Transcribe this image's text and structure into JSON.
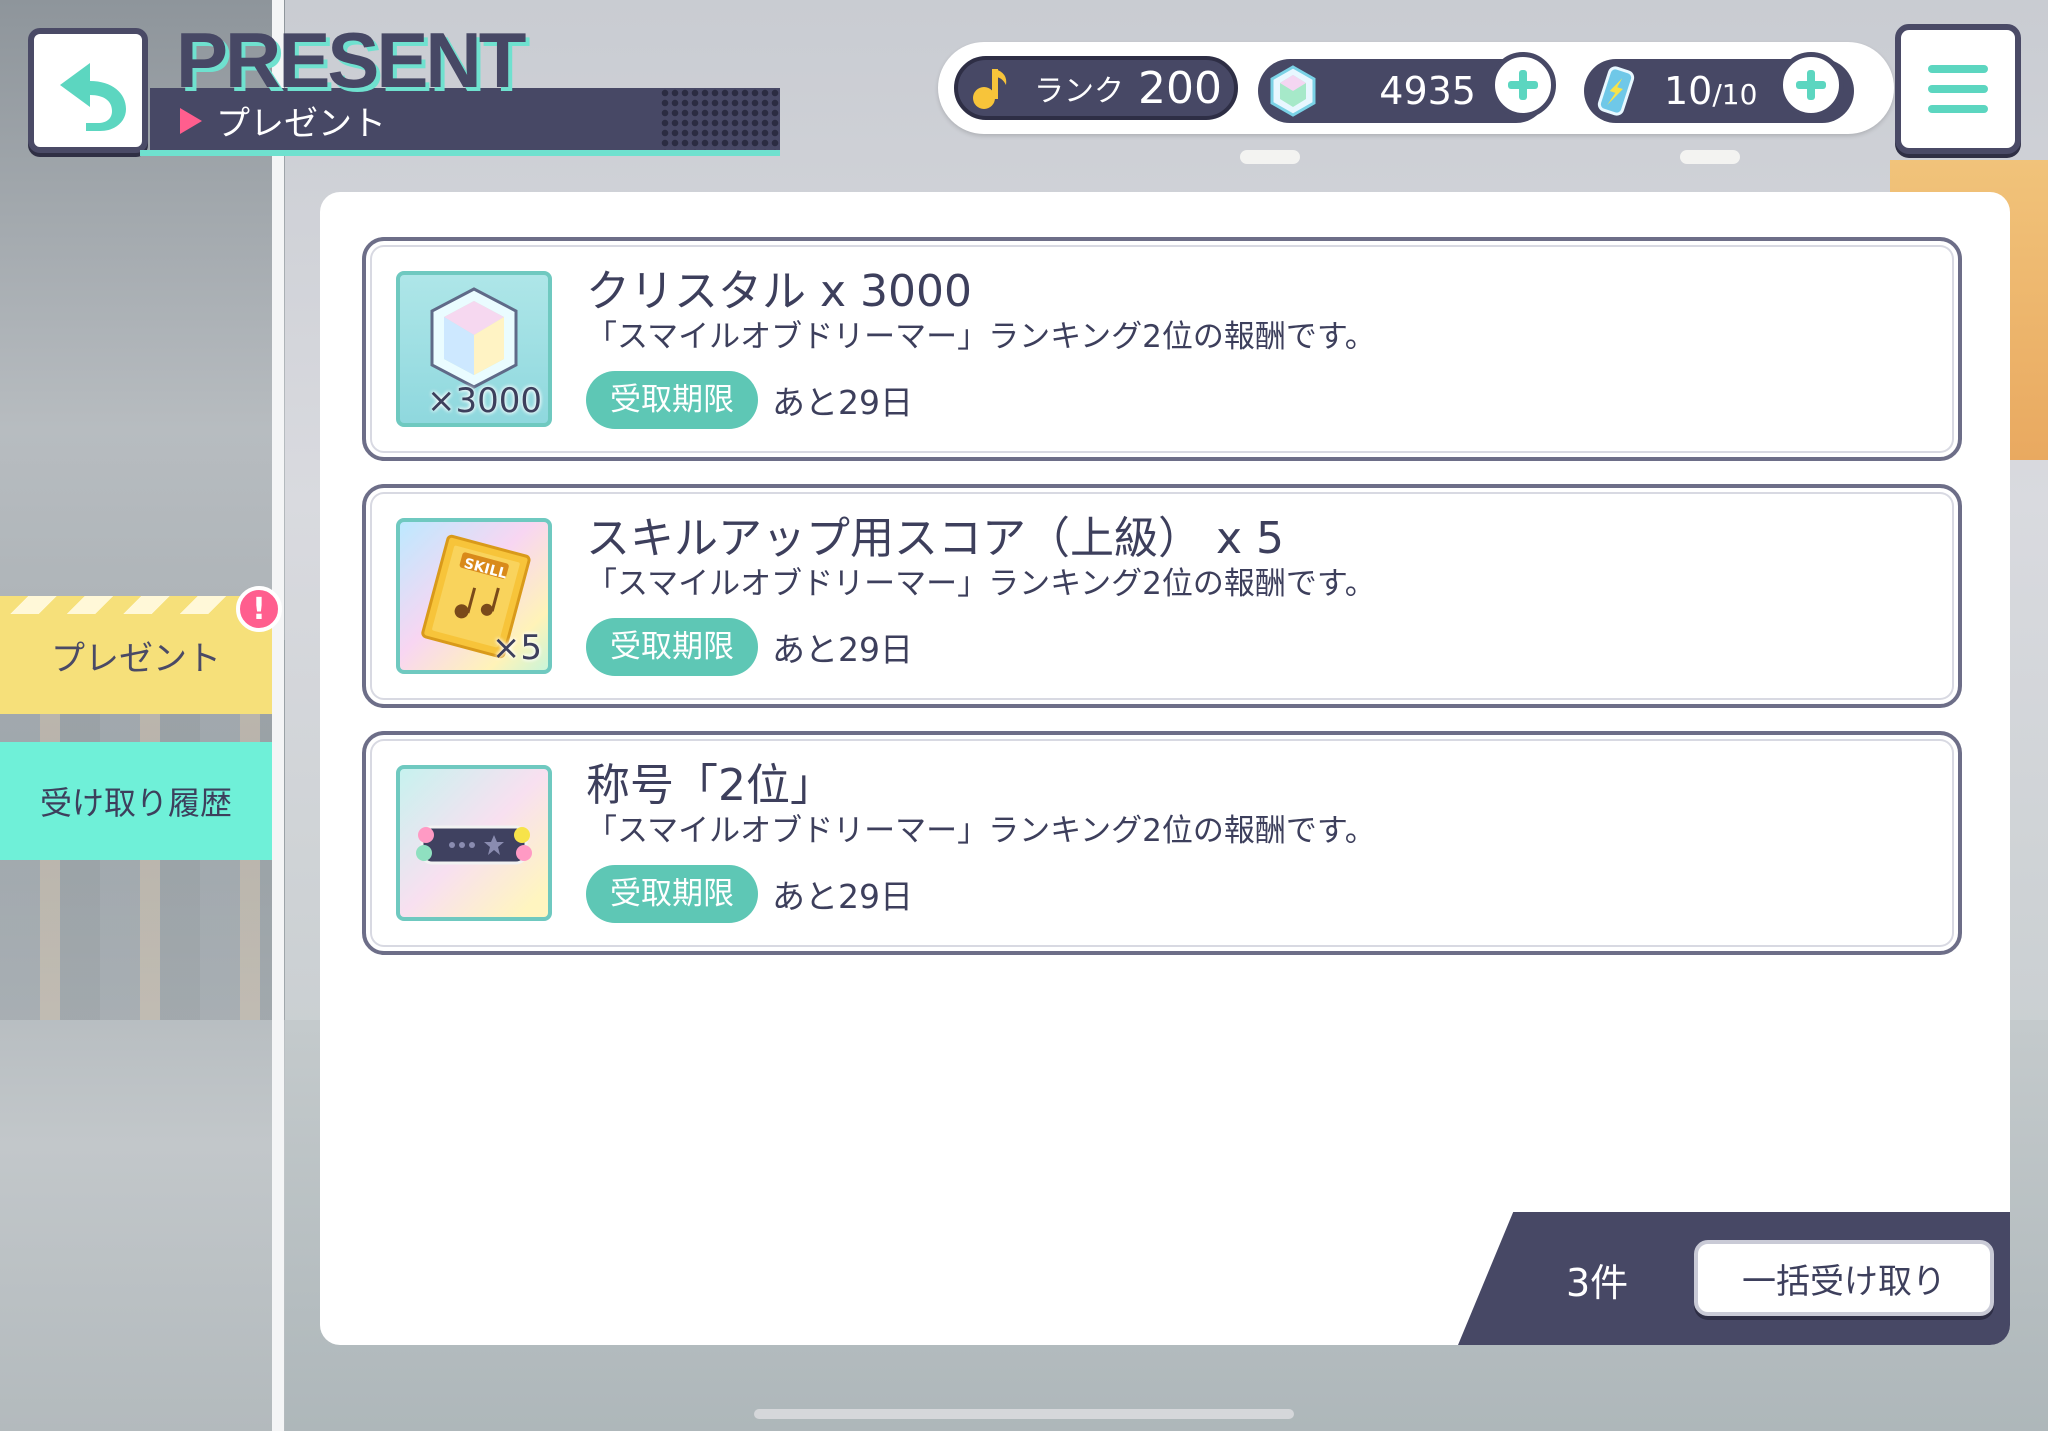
{
  "header": {
    "title_en": "PRESENT",
    "title_jp": "プレゼント"
  },
  "status": {
    "rank_label": "ランク",
    "rank_value": "200",
    "crystals": "4935",
    "energy_current": "10",
    "energy_max": "/10"
  },
  "sidebar": {
    "tabs": [
      {
        "label": "プレゼント",
        "has_alert": true,
        "alert_mark": "!"
      },
      {
        "label": "受け取り履歴"
      }
    ]
  },
  "presents": [
    {
      "title": "クリスタル x 3000",
      "description": "「スマイルオブドリーマー」ランキング2位の報酬です。",
      "deadline_label": "受取期限",
      "deadline_value": "あと29日",
      "icon_qty": "×3000",
      "icon": "crystal-icon"
    },
    {
      "title": "スキルアップ用スコア（上級） x 5",
      "description": "「スマイルオブドリーマー」ランキング2位の報酬です。",
      "deadline_label": "受取期限",
      "deadline_value": "あと29日",
      "icon_qty": "×5",
      "icon_text": "SKILL",
      "icon": "skill-score-icon"
    },
    {
      "title": "称号「2位」",
      "description": "「スマイルオブドリーマー」ランキング2位の報酬です。",
      "deadline_label": "受取期限",
      "deadline_value": "あと29日",
      "icon_qty": "",
      "icon": "title-badge-icon"
    }
  ],
  "footer": {
    "count": "3件",
    "collect_all_label": "一括受け取り"
  },
  "colors": {
    "navy": "#474865",
    "mint": "#5ec7b5",
    "accent_pink": "#ff5e8e",
    "tab_yellow": "#f6e07a",
    "tab_mint": "#6ff0d8"
  }
}
